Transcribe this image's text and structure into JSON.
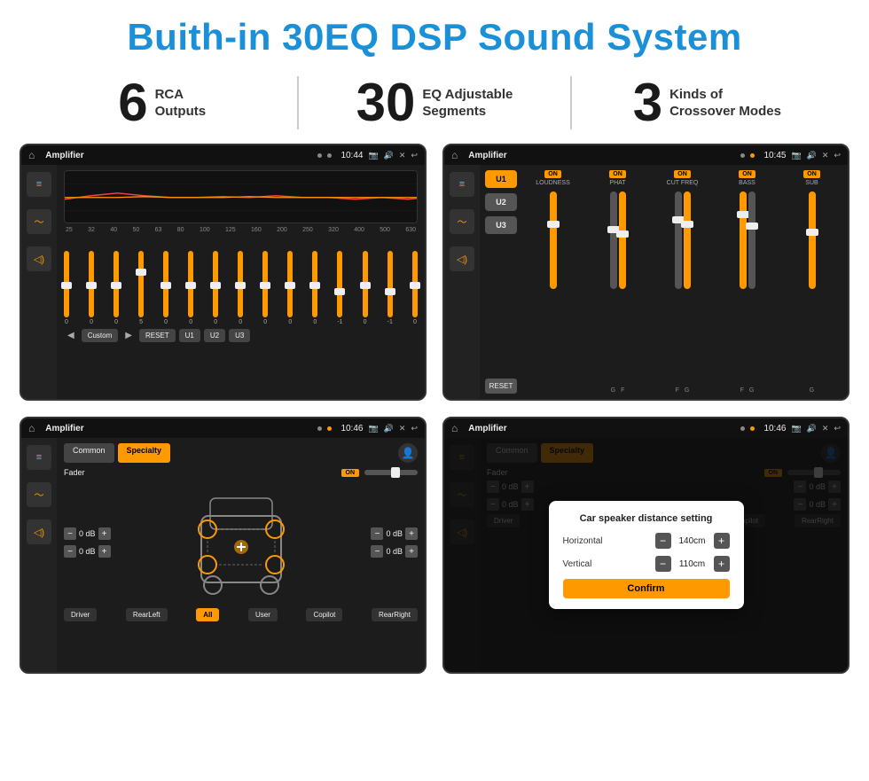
{
  "header": {
    "title": "Buith-in 30EQ DSP Sound System"
  },
  "stats": [
    {
      "number": "6",
      "label_line1": "RCA",
      "label_line2": "Outputs"
    },
    {
      "number": "30",
      "label_line1": "EQ Adjustable",
      "label_line2": "Segments"
    },
    {
      "number": "3",
      "label_line1": "Kinds of",
      "label_line2": "Crossover Modes"
    }
  ],
  "screens": [
    {
      "id": "eq-screen",
      "app": "Amplifier",
      "time": "10:44",
      "type": "eq"
    },
    {
      "id": "amp-screen",
      "app": "Amplifier",
      "time": "10:45",
      "type": "amplifier"
    },
    {
      "id": "fader-screen",
      "app": "Amplifier",
      "time": "10:46",
      "type": "fader"
    },
    {
      "id": "dialog-screen",
      "app": "Amplifier",
      "time": "10:46",
      "type": "dialog"
    }
  ],
  "eq": {
    "frequencies": [
      "25",
      "32",
      "40",
      "50",
      "63",
      "80",
      "100",
      "125",
      "160",
      "200",
      "250",
      "320",
      "400",
      "500",
      "630"
    ],
    "values": [
      "0",
      "0",
      "0",
      "5",
      "0",
      "0",
      "0",
      "0",
      "0",
      "0",
      "0",
      "-1",
      "0",
      "-1",
      "0"
    ],
    "preset": "Custom",
    "buttons": [
      "RESET",
      "U1",
      "U2",
      "U3"
    ]
  },
  "amplifier": {
    "channels": [
      {
        "name": "LOUDNESS",
        "on": true
      },
      {
        "name": "PHAT",
        "on": true
      },
      {
        "name": "CUT FREQ",
        "on": true
      },
      {
        "name": "BASS",
        "on": true
      },
      {
        "name": "SUB",
        "on": true
      }
    ],
    "u_buttons": [
      "U1",
      "U2",
      "U3"
    ],
    "reset": "RESET"
  },
  "fader": {
    "tabs": [
      "Common",
      "Specialty"
    ],
    "active_tab": "Specialty",
    "fader_label": "Fader",
    "fader_on": "ON",
    "db_values": [
      "0 dB",
      "0 dB",
      "0 dB",
      "0 dB"
    ],
    "buttons": [
      "Driver",
      "RearLeft",
      "All",
      "User",
      "Copilot",
      "RearRight"
    ]
  },
  "dialog": {
    "title": "Car speaker distance setting",
    "fields": [
      {
        "label": "Horizontal",
        "value": "140cm"
      },
      {
        "label": "Vertical",
        "value": "110cm"
      }
    ],
    "confirm_label": "Confirm"
  }
}
